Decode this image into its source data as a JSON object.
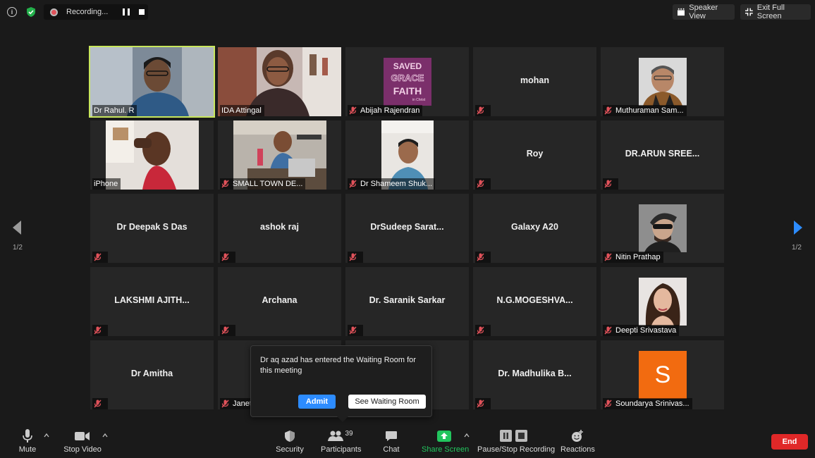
{
  "recording": {
    "label": "Recording..."
  },
  "top_buttons": {
    "speaker_view": "Speaker View",
    "exit_fullscreen": "Exit Full Screen"
  },
  "nav": {
    "page_left": "1/2",
    "page_right": "1/2"
  },
  "tiles": [
    {
      "name": "Dr Rahul. R",
      "video": true,
      "muted": false
    },
    {
      "name": "IDA Attingal",
      "video": true,
      "muted": false
    },
    {
      "name": "Abijah Rajendran",
      "video": false,
      "muted": true,
      "thumb_text": "SAVED by GRACE through FAITH in Christ"
    },
    {
      "name": "mohan",
      "video": false,
      "muted": true
    },
    {
      "name": "Muthuraman Sam...",
      "video": false,
      "muted": true
    },
    {
      "name": "iPhone",
      "video": true,
      "muted": false
    },
    {
      "name": "SMALL TOWN DE...",
      "video": true,
      "muted": true
    },
    {
      "name": "Dr Shameem Shuk...",
      "video": true,
      "muted": true
    },
    {
      "name": "Roy",
      "video": false,
      "muted": true
    },
    {
      "name": "DR.ARUN SREE...",
      "video": false,
      "muted": true
    },
    {
      "name": "Dr Deepak S Das",
      "video": false,
      "muted": true
    },
    {
      "name": "ashok raj",
      "video": false,
      "muted": true
    },
    {
      "name": "DrSudeep Sarat...",
      "video": false,
      "muted": true
    },
    {
      "name": "Galaxy A20",
      "video": false,
      "muted": true
    },
    {
      "name": "Nitin Prathap",
      "video": false,
      "muted": true
    },
    {
      "name": "LAKSHMI AJITH...",
      "video": false,
      "muted": true
    },
    {
      "name": "Archana",
      "video": false,
      "muted": true
    },
    {
      "name": "Dr. Saranik Sarkar",
      "video": false,
      "muted": true
    },
    {
      "name": "N.G.MOGESHVA...",
      "video": false,
      "muted": true
    },
    {
      "name": "Deepti Srivastava",
      "video": false,
      "muted": true
    },
    {
      "name": "Dr Amitha",
      "video": false,
      "muted": true
    },
    {
      "name": "Janet",
      "video": false,
      "muted": true
    },
    {
      "name": "",
      "video": false,
      "muted": false
    },
    {
      "name": "Dr. Madhulika B...",
      "video": false,
      "muted": true
    },
    {
      "name": "Soundarya Srinivas...",
      "video": false,
      "muted": true,
      "avatar_letter": "S"
    }
  ],
  "waiting_room": {
    "message": "Dr aq azad has entered the Waiting Room for this meeting",
    "admit": "Admit",
    "see": "See Waiting Room"
  },
  "toolbar": {
    "mute": "Mute",
    "stop_video": "Stop Video",
    "security": "Security",
    "participants": "Participants",
    "participants_count": "39",
    "chat": "Chat",
    "share_screen": "Share Screen",
    "recording": "Pause/Stop Recording",
    "reactions": "Reactions",
    "end": "End"
  },
  "colors": {
    "active_speaker": "#c8e65c",
    "accent": "#2d8cff",
    "share_green": "#22c55e",
    "end_red": "#e02828",
    "mic_off": "#e0525a"
  }
}
